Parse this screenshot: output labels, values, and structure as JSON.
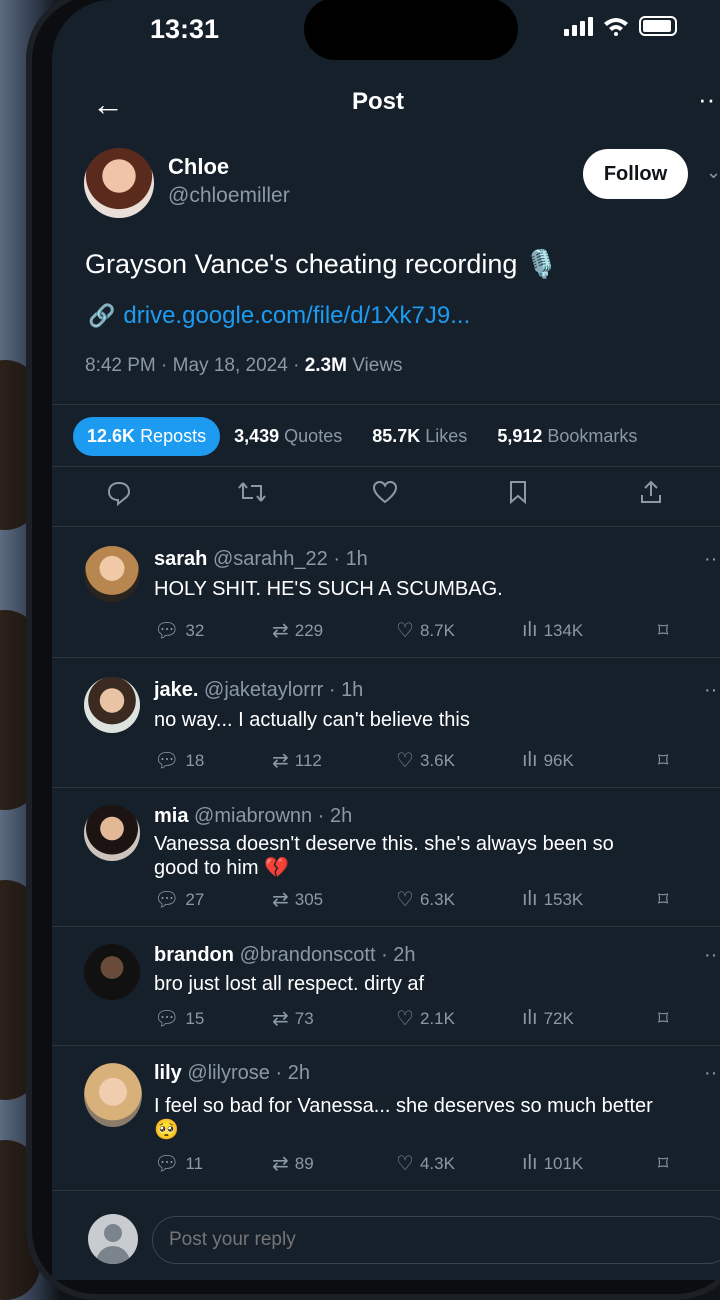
{
  "status": {
    "time": "13:31"
  },
  "header": {
    "title": "Post",
    "back_icon": "arrow-left-icon",
    "more_icon": "more-icon"
  },
  "author": {
    "name": "Chloe",
    "handle": "@chloemiller",
    "follow_label": "Follow"
  },
  "post": {
    "text": "Grayson Vance's cheating recording 🎙️",
    "link": "drive.google.com/file/d/1Xk7J9...",
    "time": "8:42 PM",
    "date": "May 18, 2024",
    "views_count": "2.3M",
    "views_label": "Views"
  },
  "stats": {
    "reposts_count": "12.6K",
    "reposts_label": "Reposts",
    "quotes_count": "3,439",
    "quotes_label": "Quotes",
    "likes_count": "85.7K",
    "likes_label": "Likes",
    "bookmarks_count": "5,912",
    "bookmarks_label": "Bookmarks"
  },
  "replies": [
    {
      "name": "sarah",
      "handle": "@sarahh_22",
      "age": "1h",
      "text": "HOLY SHIT. HE'S SUCH A SCUMBAG.",
      "replies": "32",
      "reposts": "229",
      "likes": "8.7K",
      "views": "134K"
    },
    {
      "name": "jake.",
      "handle": "@jaketaylorrr",
      "age": "1h",
      "text": "no way... I actually can't believe this",
      "replies": "18",
      "reposts": "112",
      "likes": "3.6K",
      "views": "96K"
    },
    {
      "name": "mia",
      "handle": "@miabrownn",
      "age": "2h",
      "text": "Vanessa doesn't deserve this. she's always been so good to him 💔",
      "replies": "27",
      "reposts": "305",
      "likes": "6.3K",
      "views": "153K"
    },
    {
      "name": "brandon",
      "handle": "@brandonscott",
      "age": "2h",
      "text": "bro just lost all respect. dirty af",
      "replies": "15",
      "reposts": "73",
      "likes": "2.1K",
      "views": "72K"
    },
    {
      "name": "lily",
      "handle": "@lilyrose",
      "age": "2h",
      "text": "I feel so bad for Vanessa... she deserves so much better 🥺",
      "replies": "11",
      "reposts": "89",
      "likes": "4.3K",
      "views": "101K"
    }
  ],
  "composer": {
    "placeholder": "Post your reply"
  },
  "colors": {
    "background": "#15202b",
    "accent": "#1d9bf0",
    "muted": "#8b98a5"
  }
}
